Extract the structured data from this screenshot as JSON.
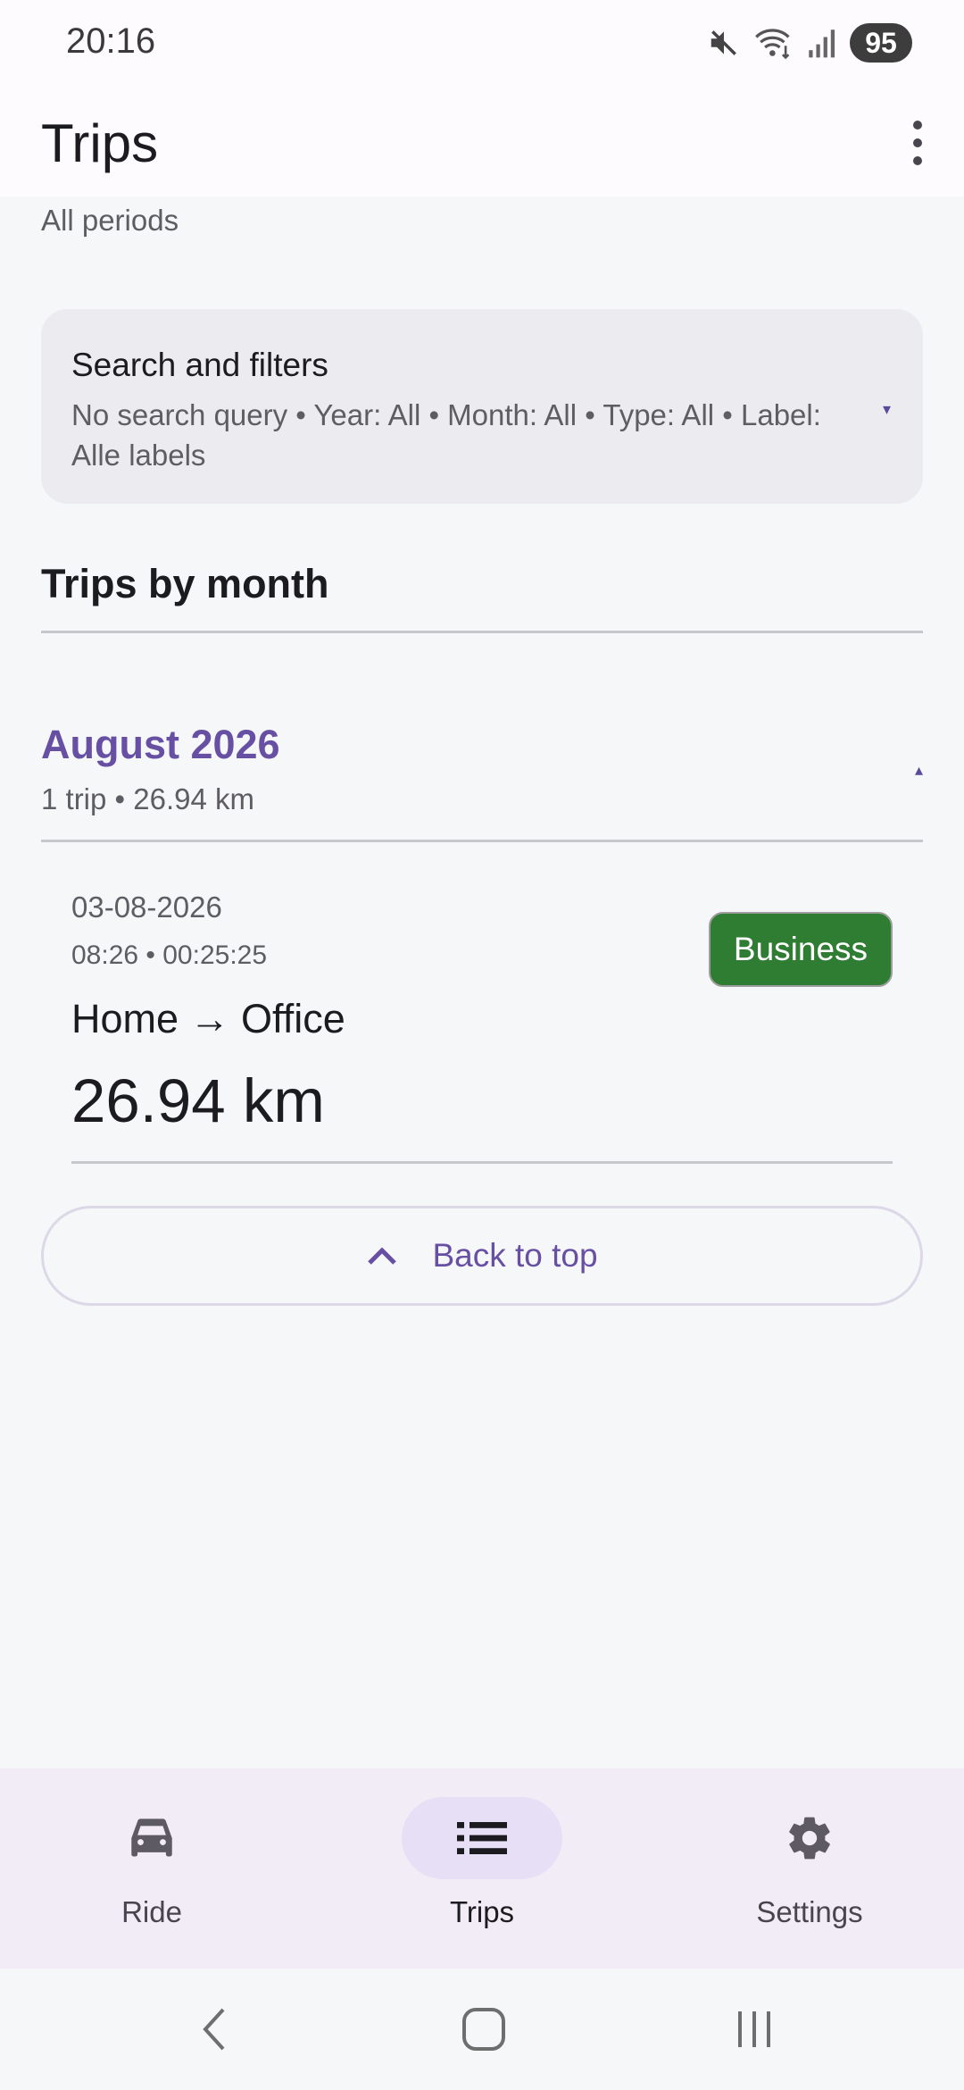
{
  "status_bar": {
    "time": "20:16",
    "battery": "95",
    "icons": [
      "mute-icon",
      "wifi-icon",
      "signal-icon",
      "battery-icon"
    ]
  },
  "app_bar": {
    "title": "Trips",
    "menu_icon": "more-vert-icon"
  },
  "period_label": "All periods",
  "filters": {
    "title": "Search and filters",
    "summary": "No search query • Year: All • Month: All • Type: All • Label: Alle labels",
    "expand_icon": "▾"
  },
  "section_title": "Trips by month",
  "months": [
    {
      "title": "August 2026",
      "summary": "1 trip • 26.94 km",
      "collapse_icon": "▴",
      "trips": [
        {
          "date": "03-08-2026",
          "time": "08:26 • 00:25:25",
          "route": "Home → Office",
          "distance": "26.94 km",
          "type": "Business"
        }
      ]
    }
  ],
  "back_to_top": "Back to top",
  "bottom_nav": [
    {
      "label": "Ride",
      "icon": "car-icon",
      "active": false
    },
    {
      "label": "Trips",
      "icon": "list-icon",
      "active": true
    },
    {
      "label": "Settings",
      "icon": "gear-icon",
      "active": false
    }
  ],
  "colors": {
    "accent": "#6750a4",
    "business_badge": "#2e7d32",
    "background": "#f6f7f9",
    "nav_background": "#f1ecf6"
  }
}
